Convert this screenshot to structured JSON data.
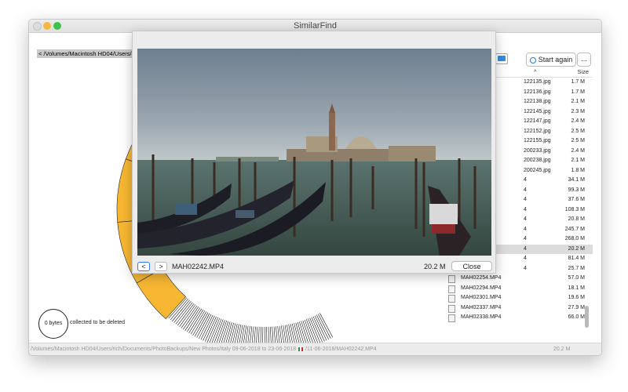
{
  "window": {
    "title": "SimilarFind"
  },
  "path_field": {
    "value": "< /Volumes/Macintosh HD04/Users/rich/"
  },
  "toolbar": {
    "start_label": "Start again",
    "more_label": "..."
  },
  "table": {
    "header_sort_glyph": "^",
    "size_header": "Size",
    "rows": [
      {
        "name": "122135.jpg",
        "size": "1.7 M",
        "selected": false,
        "icon": false
      },
      {
        "name": "122136.jpg",
        "size": "1.7 M",
        "selected": false,
        "icon": false
      },
      {
        "name": "122138.jpg",
        "size": "2.1 M",
        "selected": false,
        "icon": false
      },
      {
        "name": "122145.jpg",
        "size": "2.3 M",
        "selected": false,
        "icon": false
      },
      {
        "name": "122147.jpg",
        "size": "2.4 M",
        "selected": false,
        "icon": false
      },
      {
        "name": "122152.jpg",
        "size": "2.5 M",
        "selected": false,
        "icon": false
      },
      {
        "name": "122155.jpg",
        "size": "2.5 M",
        "selected": false,
        "icon": false
      },
      {
        "name": "200233.jpg",
        "size": "2.4 M",
        "selected": false,
        "icon": false
      },
      {
        "name": "200238.jpg",
        "size": "2.1 M",
        "selected": false,
        "icon": false
      },
      {
        "name": "200245.jpg",
        "size": "1.8 M",
        "selected": false,
        "icon": false
      },
      {
        "name": "4",
        "size": "34.1 M",
        "selected": false,
        "icon": false
      },
      {
        "name": "4",
        "size": "99.3 M",
        "selected": false,
        "icon": false
      },
      {
        "name": "4",
        "size": "37.6 M",
        "selected": false,
        "icon": false
      },
      {
        "name": "4",
        "size": "108.3 M",
        "selected": false,
        "icon": false
      },
      {
        "name": "4",
        "size": "20.8 M",
        "selected": false,
        "icon": false
      },
      {
        "name": "4",
        "size": "245.7 M",
        "selected": false,
        "icon": false
      },
      {
        "name": "4",
        "size": "268.0 M",
        "selected": false,
        "icon": false
      },
      {
        "name": "4",
        "size": "20.2 M",
        "selected": true,
        "icon": false
      },
      {
        "name": "4",
        "size": "81.4 M",
        "selected": false,
        "icon": false
      },
      {
        "name": "4",
        "size": "25.7 M",
        "selected": false,
        "icon": false
      },
      {
        "name": "MAH02254.MP4",
        "size": "57.0 M",
        "selected": false,
        "icon": true
      },
      {
        "name": "MAH02294.MP4",
        "size": "18.1 M",
        "selected": false,
        "icon": true
      },
      {
        "name": "MAH02301.MP4",
        "size": "19.6 M",
        "selected": false,
        "icon": true
      },
      {
        "name": "MAH02337.MP4",
        "size": "27.9 M",
        "selected": false,
        "icon": true
      },
      {
        "name": "MAH02338.MP4",
        "size": "66.0 M",
        "selected": false,
        "icon": true
      }
    ]
  },
  "collector": {
    "size": "0 bytes",
    "label": "collected to be deleted"
  },
  "status": {
    "path_part1": "/Volumes/Macintosh HD04/Users/rich/Documents/PhotoBackups/New Photos/Italy 09-06-2018 to 23-06-2018",
    "path_part2": "/11-06-2018/MAH02242.MP4",
    "size": "20.2 M"
  },
  "preview": {
    "prev_label": "<",
    "next_label": ">",
    "filename": "MAH02242.MP4",
    "size": "20.2 M",
    "close_label": "Close"
  },
  "colors": {
    "sunburst": "#f7b733",
    "accent": "#2f7ef0"
  }
}
